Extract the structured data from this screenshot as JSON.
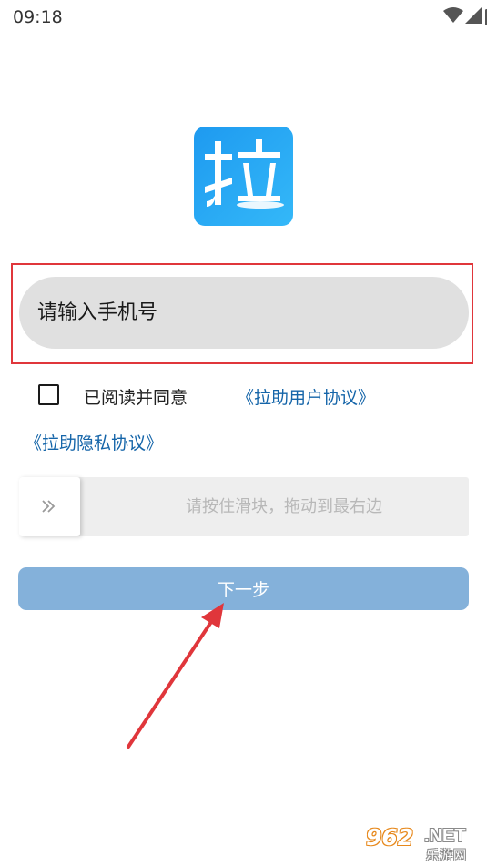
{
  "status_bar": {
    "time": "09:18",
    "icons": [
      "wifi-icon",
      "cell-signal-icon",
      "battery-charging-icon"
    ]
  },
  "app": {
    "logo_char": "拉",
    "logo_colors": [
      "#1e9af0",
      "#2fb4f7"
    ]
  },
  "login_form": {
    "phone_placeholder": "请输入手机号",
    "agree_text": "已阅读并同意",
    "agreement_link": "《拉助用户协议》",
    "privacy_link": "《拉助隐私协议》",
    "slider_hint": "请按住滑块，拖动到最右边",
    "slider_handle_icon": "double-chevron-right-icon",
    "next_label": "下一步"
  },
  "annotations": {
    "highlight_color": "#e0363b",
    "arrow_color": "#e0363b"
  },
  "watermark": {
    "brand": "962",
    "suffix": ".NET",
    "site": "乐游网"
  },
  "colors": {
    "link": "#1565a9",
    "button": "#84b1da",
    "input_bg": "#e0e0e0"
  }
}
